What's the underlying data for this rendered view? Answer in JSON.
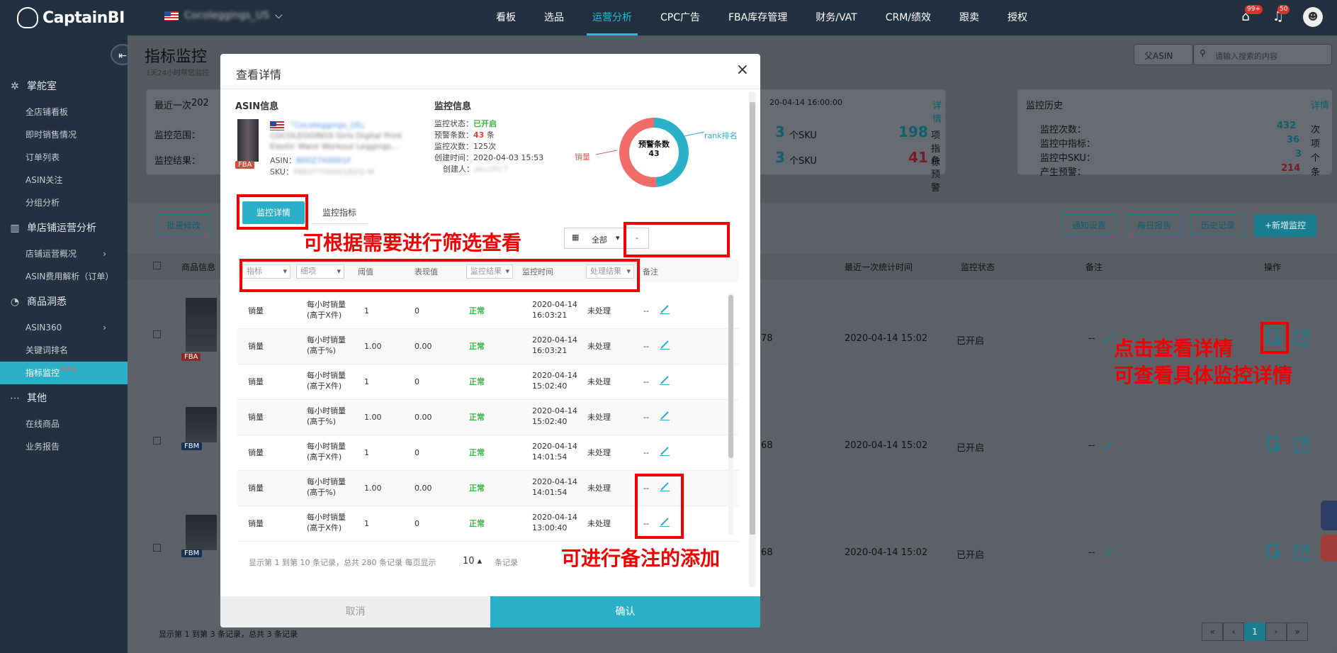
{
  "app": {
    "brand": "CaptainBI",
    "store": "Cocoleggings_US"
  },
  "nav": {
    "items": [
      "看板",
      "选品",
      "运营分析",
      "CPC广告",
      "FBA库存管理",
      "财务/VAT",
      "CRM/绩效",
      "跟卖",
      "授权"
    ],
    "badge_msg": "99+",
    "badge_bell": "50"
  },
  "sidebar": {
    "group1": "掌舵室",
    "g1items": [
      "全店铺看板",
      "即时销售情况",
      "订单列表",
      "ASIN关注",
      "分组分析"
    ],
    "group2": "单店铺运营分析",
    "g2items": [
      "店铺运营概况",
      "ASIN费用解析（订单）"
    ],
    "group3": "商品洞悉",
    "g3items": [
      "ASIN360",
      "关键词排名",
      "指标监控"
    ],
    "beta": "beta",
    "group4": "其他",
    "g4items": [
      "在线商品",
      "业务报告"
    ]
  },
  "main": {
    "title": "指标监控",
    "subtitle": "1天24小时帮您监控",
    "recent_label": "最近一次",
    "recent_val": "202",
    "scope_label": "监控范围：",
    "result_label": "监控结果：",
    "time_top": "20-04-14 16:00:00",
    "detail": "详情",
    "sku1": "个SKU",
    "sku2": "个SKU",
    "n3a": "3",
    "n3b": "3",
    "n198": "198",
    "items_label": "项指标",
    "n41": "41",
    "warn_label": "条预警",
    "history": {
      "title": "监控历史",
      "detail": "详情",
      "rows": [
        {
          "label": "监控次数：",
          "value": "432",
          "unit": "次"
        },
        {
          "label": "监控中指标：",
          "value": "36",
          "unit": "项"
        },
        {
          "label": "监控中SKU：",
          "value": "3",
          "unit": "个"
        },
        {
          "label": "产生预警：",
          "value": "214",
          "unit": "条"
        }
      ]
    },
    "btn_batch": "批量修改",
    "btn_notify": "通知设置",
    "btn_daily": "每日报告",
    "btn_hist": "历史记录",
    "btn_add": "+新增监控",
    "col_product": "商品信息",
    "col_last": "最近一次统计时间",
    "col_status": "监控状态",
    "col_note": "备注",
    "col_op": "操作",
    "rows": [
      {
        "n": "78",
        "time": "2020-04-14 15:02",
        "status": "已开启",
        "note": "--",
        "tag": "FBA"
      },
      {
        "n": "68",
        "time": "2020-04-14 15:02",
        "status": "已开启",
        "note": "--",
        "tag": "FBM"
      },
      {
        "n": "68",
        "time": "2020-04-14 15:02",
        "status": "已开启",
        "note": "--",
        "tag": "FBM"
      }
    ],
    "footer": "显示第 1 到第 3 条记录，总共 3 条记录",
    "pages": [
      "«",
      "‹",
      "1",
      "›",
      "»"
    ],
    "parent_asin": "父ASIN",
    "search_ph": "请输入搜索的内容"
  },
  "modal": {
    "title": "查看详情",
    "close": "×",
    "asin_head": "ASIN信息",
    "mon_head": "监控信息",
    "store": "「Cocoleggings_US」",
    "product": "COCOLEGGINGS Girls Digital Print Elastic Waist Workout Leggings...",
    "asin_label": "ASIN：",
    "asin": "B00Z7X0001F",
    "sku_label": "SKU：",
    "sku": "PBK0TY00001BZQ-M",
    "fba": "FBA",
    "status_label": "监控状态：",
    "status": "已开启",
    "warn_label": "预警条数：",
    "warn": "43",
    "warn_unit": "条",
    "times": "监控次数：125次",
    "created": "创建时间：2020-04-03 15:53",
    "creator_label": "创建人：",
    "creator": "jalu2017",
    "donut_title": "预警条数",
    "donut_value": "43",
    "tab1": "监控详情",
    "tab2": "监控指标",
    "date_filter": "全部",
    "date_dash": "-",
    "head": {
      "f1": "指标",
      "f2": "细项",
      "h3": "阈值",
      "h4": "表现值",
      "f5": "监控结果",
      "h6": "监控时间",
      "f7": "处理结果",
      "h8": "备注"
    },
    "rows": [
      {
        "metric": "销量",
        "item1": "每小时销量",
        "item2": "(高于X件)",
        "th": "1",
        "val": "0",
        "res": "正常",
        "d": "2020-04-14",
        "t": "16:03:21",
        "proc": "未处理",
        "note": "--"
      },
      {
        "metric": "销量",
        "item1": "每小时销量",
        "item2": "(高于%)",
        "th": "1.00",
        "val": "0.00",
        "res": "正常",
        "d": "2020-04-14",
        "t": "16:03:21",
        "proc": "未处理",
        "note": "--"
      },
      {
        "metric": "销量",
        "item1": "每小时销量",
        "item2": "(高于X件)",
        "th": "1",
        "val": "0",
        "res": "正常",
        "d": "2020-04-14",
        "t": "15:02:40",
        "proc": "未处理",
        "note": "--"
      },
      {
        "metric": "销量",
        "item1": "每小时销量",
        "item2": "(高于%)",
        "th": "1.00",
        "val": "0.00",
        "res": "正常",
        "d": "2020-04-14",
        "t": "15:02:40",
        "proc": "未处理",
        "note": "--"
      },
      {
        "metric": "销量",
        "item1": "每小时销量",
        "item2": "(高于X件)",
        "th": "1",
        "val": "0",
        "res": "正常",
        "d": "2020-04-14",
        "t": "14:01:54",
        "proc": "未处理",
        "note": "--"
      },
      {
        "metric": "销量",
        "item1": "每小时销量",
        "item2": "(高于%)",
        "th": "1.00",
        "val": "0.00",
        "res": "正常",
        "d": "2020-04-14",
        "t": "14:01:54",
        "proc": "未处理",
        "note": "--"
      },
      {
        "metric": "销量",
        "item1": "每小时销量",
        "item2": "(高于X件)",
        "th": "1",
        "val": "0",
        "res": "正常",
        "d": "2020-04-14",
        "t": "13:00:40",
        "proc": "未处理",
        "note": "--"
      }
    ],
    "pager": "显示第 1 到第 10 条记录，总共 280 条记录 每页显示",
    "psize": "10 ▴",
    "psuffix": "条记录",
    "cancel": "取消",
    "confirm": "确认"
  },
  "chart_data": {
    "type": "pie",
    "categories": [
      "rank排名",
      "销量"
    ],
    "values": [
      21,
      22
    ],
    "title": "预警条数 43",
    "colors": [
      "#2bb0c9",
      "#f26b6b"
    ]
  },
  "annotations": {
    "filter": "可根据需要进行筛选查看",
    "detail1": "点击查看详情",
    "detail2": "可查看具体监控详情",
    "note": "可进行备注的添加"
  },
  "colors": {
    "accent": "#2bb0c9",
    "nav_bg": "#22313f",
    "annot": "#f10000"
  }
}
